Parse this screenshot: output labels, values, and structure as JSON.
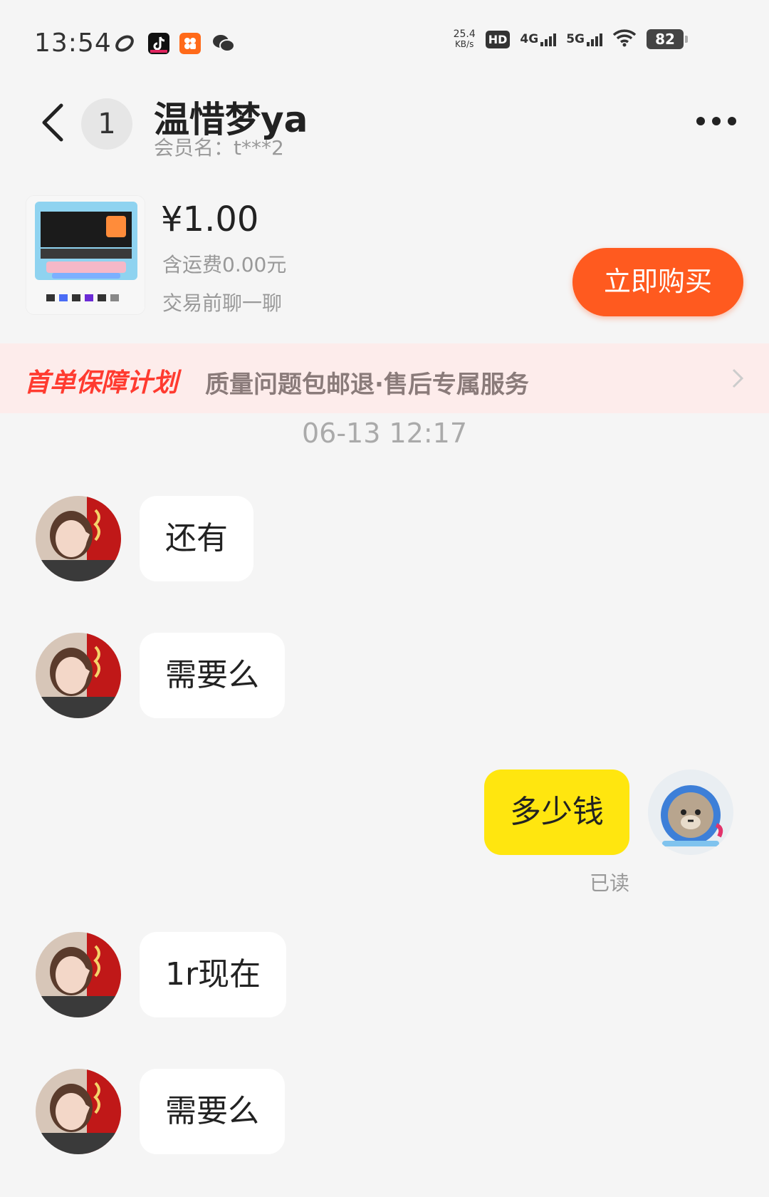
{
  "status_bar": {
    "time": "13:54",
    "speed_value": "25.4",
    "speed_unit": "KB/s",
    "hd": "HD",
    "net_4g": "4G",
    "net_5g": "5G",
    "battery": "82",
    "app_icons": [
      "link-icon",
      "tiktok-icon",
      "orange-app-icon",
      "wechat-icon"
    ]
  },
  "header": {
    "back_icon": "chevron-left-icon",
    "unread_count": "1",
    "nickname": "温惜梦ya",
    "member_name": "会员名：t***2",
    "more_icon": "more-dots-icon"
  },
  "product": {
    "price": "¥1.00",
    "shipping": "含运费0.00元",
    "chat_hint": "交易前聊一聊",
    "buy_label": "立即购买",
    "accent": "#ff5a1f"
  },
  "guarantee": {
    "title": "首单保障计划",
    "description": "质量问题包邮退·售后专属服务"
  },
  "chat": {
    "timestamp": "06-13 12:17",
    "messages": [
      {
        "from": "other",
        "text": "还有"
      },
      {
        "from": "other",
        "text": "需要么"
      },
      {
        "from": "me",
        "text": "多少钱",
        "status": "已读"
      },
      {
        "from": "other",
        "text": "1r现在"
      },
      {
        "from": "other",
        "text": "需要么"
      }
    ],
    "my_bubble_color": "#ffe60f"
  }
}
